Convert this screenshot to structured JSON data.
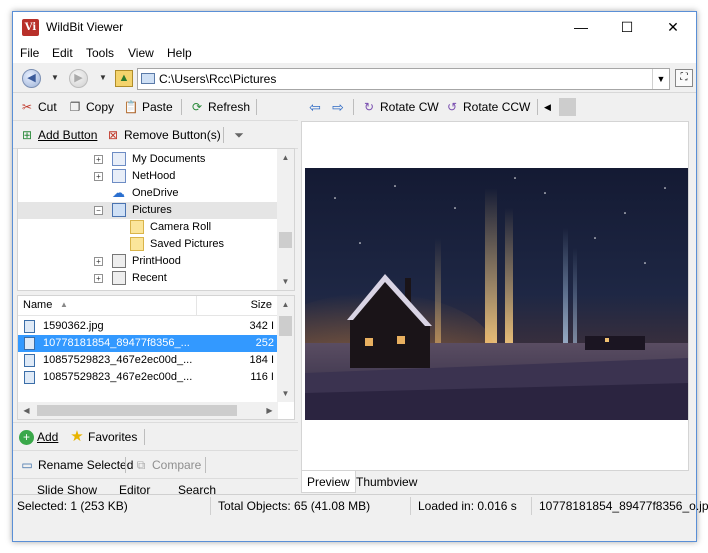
{
  "window": {
    "title": "WildBit Viewer",
    "app_icon_text": "Vi",
    "controls": {
      "minimize": "—",
      "maximize": "☐",
      "close": "✕"
    }
  },
  "menu": [
    "File",
    "Edit",
    "Tools",
    "View",
    "Help"
  ],
  "address": {
    "path": "C:\\Users\\Rcc\\Pictures",
    "back_icon": "back-arrow-icon",
    "forward_icon": "forward-arrow-icon",
    "up_icon": "folder-up-icon"
  },
  "left_toolbar1": {
    "cut": "Cut",
    "copy": "Copy",
    "paste": "Paste",
    "refresh": "Refresh"
  },
  "left_toolbar2": {
    "add_button": "Add Button",
    "remove_buttons": "Remove Button(s)"
  },
  "tree": {
    "items": [
      {
        "label": "My Documents",
        "expander": "+",
        "icon": "documents-icon"
      },
      {
        "label": "NetHood",
        "expander": "+",
        "icon": "network-icon"
      },
      {
        "label": "OneDrive",
        "expander": "",
        "icon": "cloud-icon"
      },
      {
        "label": "Pictures",
        "expander": "−",
        "icon": "pictures-icon"
      },
      {
        "label": "Camera Roll",
        "expander": "",
        "icon": "folder-icon"
      },
      {
        "label": "Saved Pictures",
        "expander": "",
        "icon": "folder-icon"
      },
      {
        "label": "PrintHood",
        "expander": "+",
        "icon": "printer-icon"
      },
      {
        "label": "Recent",
        "expander": "+",
        "icon": "recent-icon"
      }
    ]
  },
  "filelist": {
    "headers": {
      "name": "Name",
      "size": "Size"
    },
    "rows": [
      {
        "name": "1590362.jpg",
        "size": "342 I"
      },
      {
        "name": "10778181854_89477f8356_...",
        "size": "252"
      },
      {
        "name": "10857529823_467e2ec00d_...",
        "size": "184 I"
      },
      {
        "name": "10857529823_467e2ec00d_...",
        "size": "116 I"
      }
    ]
  },
  "left_bottom1": {
    "add": "Add",
    "favorites": "Favorites"
  },
  "left_bottom2": {
    "rename": "Rename Selected",
    "compare": "Compare"
  },
  "left_tabs": [
    "Slide Show",
    "Editor",
    "Search"
  ],
  "right_toolbar": {
    "rotate_cw": "Rotate CW",
    "rotate_ccw": "Rotate CCW"
  },
  "right_tabs": [
    "Preview",
    "Thumbview"
  ],
  "status": {
    "selected": "Selected: 1 (253 KB)",
    "total": "Total Objects: 65 (41.08 MB)",
    "loaded": "Loaded in: 0.016 s",
    "filename": "10778181854_89477f8356_o.jp"
  },
  "colors": {
    "selection": "#3399ff",
    "accent": "#2e6ac4"
  }
}
